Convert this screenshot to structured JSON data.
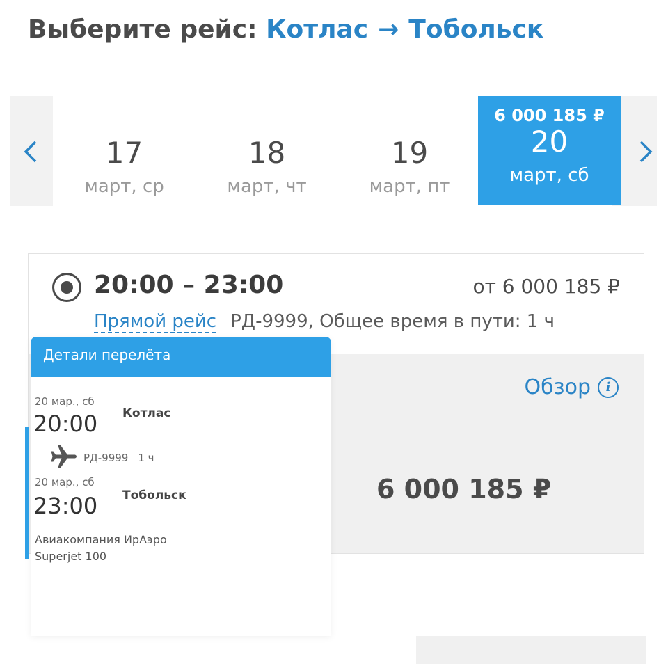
{
  "header": {
    "prefix": "Выберите рейс:",
    "origin": "Котлас",
    "arrow": "→",
    "destination": "Тобольск"
  },
  "dates": [
    {
      "day": "17",
      "weekday": "март, ср",
      "price": ""
    },
    {
      "day": "18",
      "weekday": "март, чт",
      "price": ""
    },
    {
      "day": "19",
      "weekday": "март, пт",
      "price": ""
    },
    {
      "day": "20",
      "weekday": "март, сб",
      "price": "6 000 185 ₽"
    }
  ],
  "nav": {
    "prev_icon": "chevron-left-icon",
    "next_icon": "chevron-right-icon"
  },
  "flight": {
    "time_range": "20:00 – 23:00",
    "from_price": "от 6 000 185 ₽",
    "direct_label": "Прямой рейс",
    "details": "РД-9999, Общее время в пути: 1 ч",
    "overview_label": "Обзор",
    "info_icon_glyph": "i",
    "price": "6 000 185 ₽"
  },
  "popup": {
    "title": "Детали перелёта",
    "departure": {
      "date": "20 мар., сб",
      "time": "20:00",
      "city": "Котлас"
    },
    "segment": {
      "flight_no": "РД-9999",
      "duration": "1 ч"
    },
    "arrival": {
      "date": "20 мар., сб",
      "time": "23:00",
      "city": "Тобольск"
    },
    "airline": "Авиакомпания ИрАэро",
    "aircraft": "Superjet 100"
  },
  "colors": {
    "accent": "#2ea0e6",
    "link": "#2a84c6",
    "text": "#4a4a4a"
  }
}
